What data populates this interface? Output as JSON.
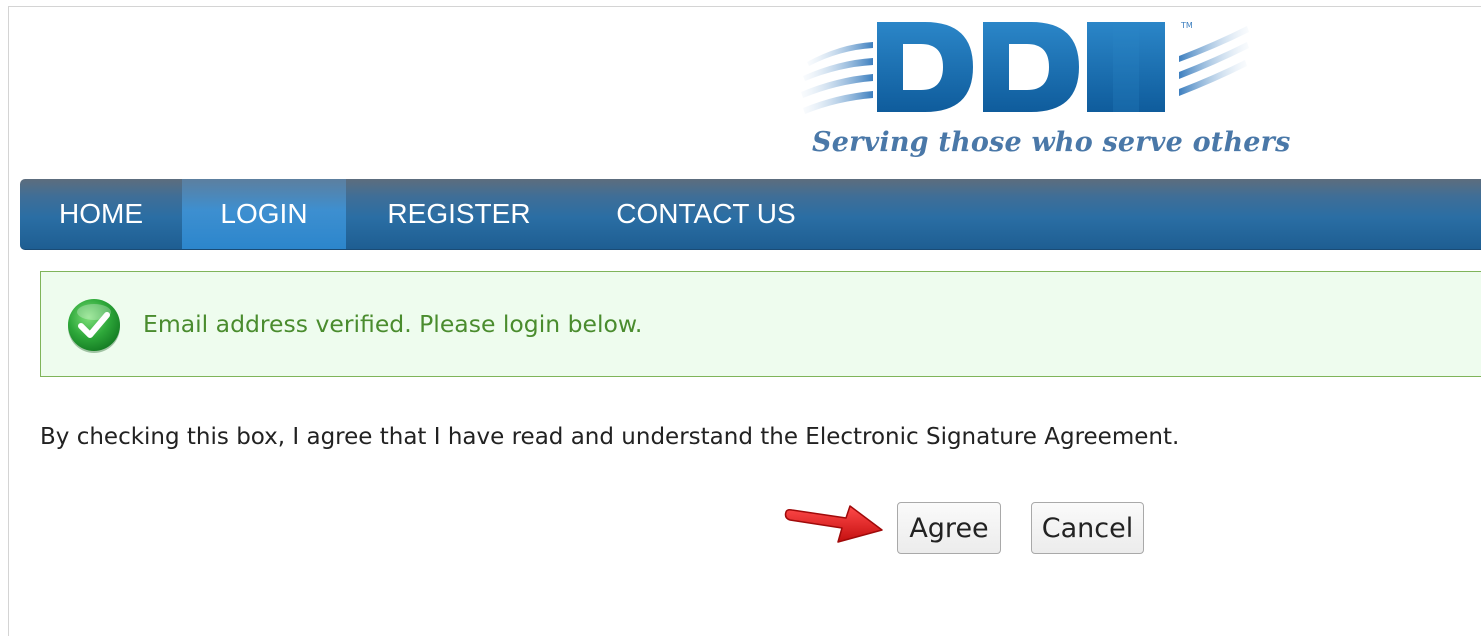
{
  "header": {
    "logo_text": "DDI",
    "tagline": "Serving those who serve others"
  },
  "nav": {
    "items": [
      {
        "label": "HOME",
        "active": false
      },
      {
        "label": "LOGIN",
        "active": true
      },
      {
        "label": "REGISTER",
        "active": false
      },
      {
        "label": "CONTACT US",
        "active": false
      }
    ]
  },
  "alert": {
    "icon": "check-circle-icon",
    "message": "Email address verified. Please login below."
  },
  "agreement": {
    "text": "By checking this box, I agree that I have read and understand the Electronic Signature Agreement."
  },
  "buttons": {
    "agree_label": "Agree",
    "cancel_label": "Cancel"
  },
  "annotation": {
    "icon": "red-arrow-icon"
  },
  "colors": {
    "brand_blue": "#1f6fb0",
    "nav_active": "#2c86cc",
    "success_text": "#4a8c2e",
    "success_bg": "#eefcee",
    "arrow_red": "#d81e1e"
  }
}
